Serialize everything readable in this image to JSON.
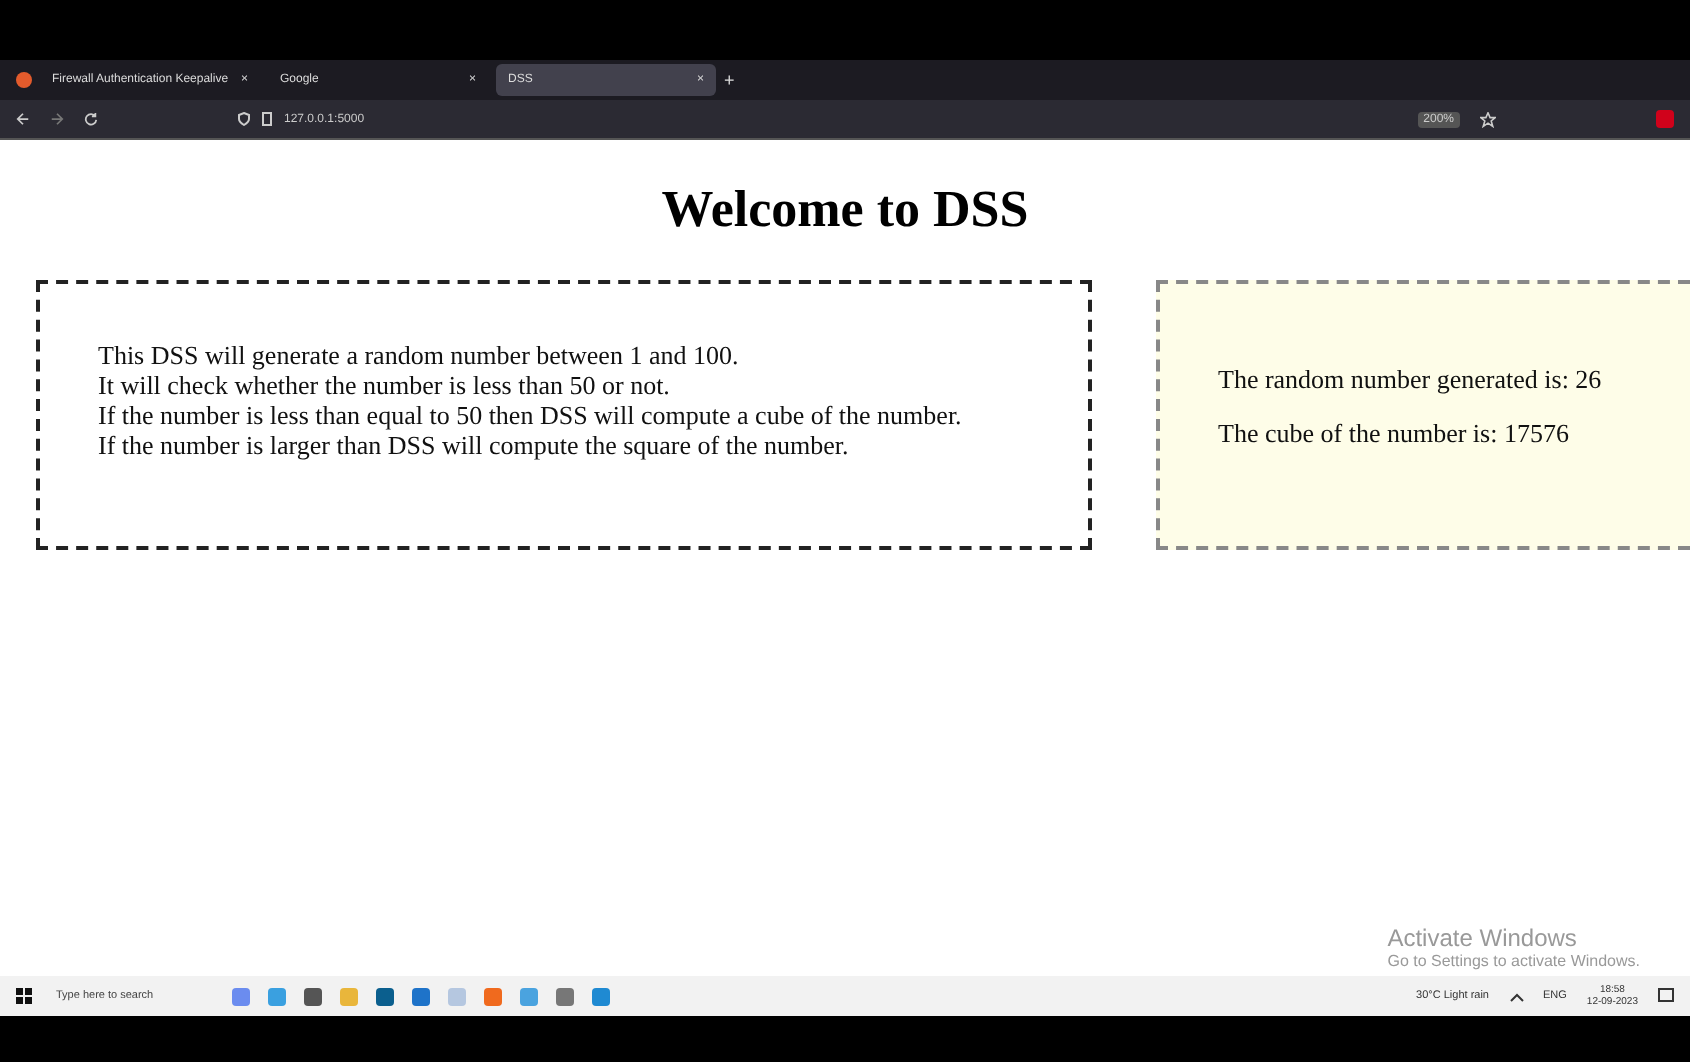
{
  "browser": {
    "tabs": [
      {
        "title": "Firewall Authentication Keepalive",
        "close": "×",
        "selected": false
      },
      {
        "title": "Google",
        "close": "×",
        "selected": false
      },
      {
        "title": "DSS",
        "close": "×",
        "selected": true
      }
    ],
    "new_tab": "+",
    "url": "127.0.0.1:5000",
    "zoom": "200%"
  },
  "page": {
    "heading": "Welcome to DSS",
    "description": [
      "This DSS will generate a random number between 1 and 100.",
      "It will check whether the number is less than 50 or not.",
      "If the number is less than equal to 50 then DSS will compute a cube of the number.",
      "If the number is larger than DSS will compute the square of the number."
    ],
    "results": [
      "The random number generated is: 26",
      "The cube of the number is: 17576"
    ]
  },
  "activation": {
    "title": "Activate Windows",
    "subtitle": "Go to Settings to activate Windows."
  },
  "taskbar": {
    "search_placeholder": "Type here to search",
    "weather": "30°C  Light rain",
    "language": "ENG",
    "time": "18:58",
    "date": "12-09-2023"
  }
}
